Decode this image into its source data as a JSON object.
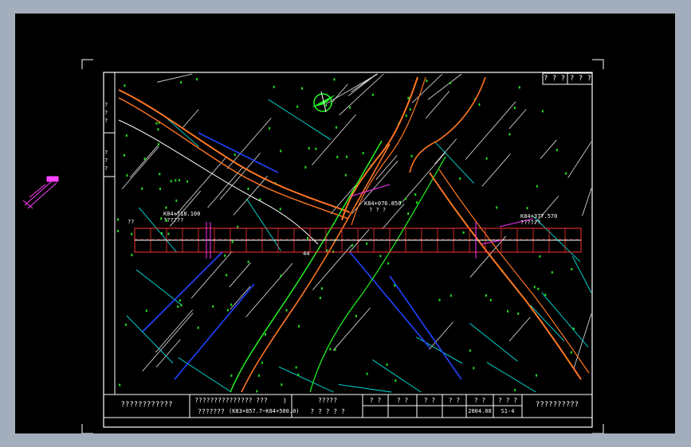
{
  "sheet": {
    "corner_marks": [
      "? ? ?",
      "? ? ?"
    ],
    "side_labels": [
      "? ? ?",
      "? ? ?"
    ]
  },
  "annotations": {
    "station_left": "K84+718.100",
    "station_left_sub": "??????",
    "station_center": "K84+076.850",
    "station_center_sub": "? ? ?",
    "station_right": "K84+377.570",
    "station_right_sub": "??????",
    "left_tag": "??",
    "cross_point": "44"
  },
  "title_block": {
    "project": "????????????",
    "drawing_title": "??????????????? ???    )",
    "drawing_sub": "???????",
    "range": "(K83+857.7~K84+500.0)",
    "designer_label": "?????",
    "designer_sub": "? ? ? ? ?",
    "col1": "? ?",
    "col2": "? ?",
    "col3": "? ?",
    "col4": "? ?",
    "col5": "? ?",
    "col6": "? ? ?",
    "date": "2004.08",
    "sheet_no": "S1-4",
    "right_box": "??????????"
  }
}
